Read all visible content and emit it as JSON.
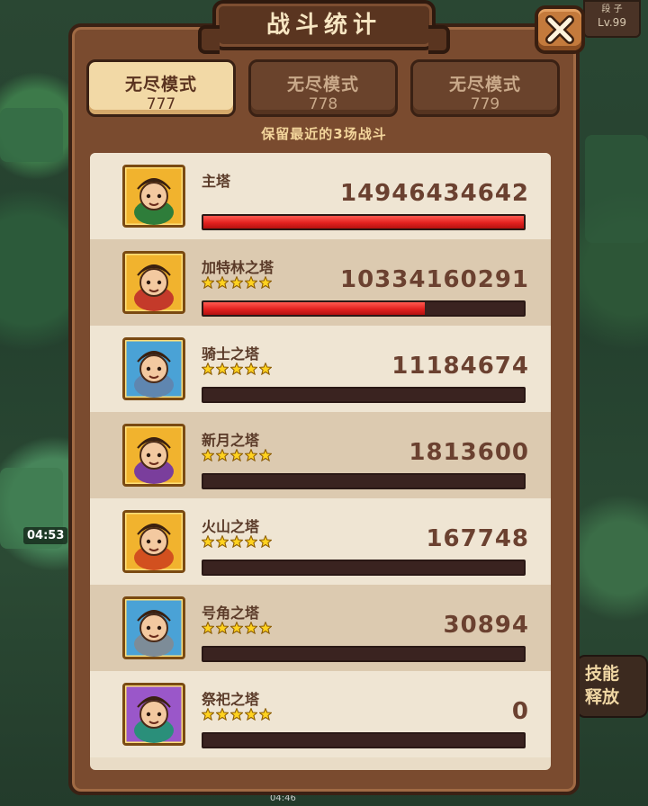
{
  "title": "战斗统计",
  "tabs": [
    {
      "mode": "无尽模式",
      "number": "777",
      "active": true
    },
    {
      "mode": "无尽模式",
      "number": "778",
      "active": false
    },
    {
      "mode": "无尽模式",
      "number": "779",
      "active": false
    }
  ],
  "subtitle": "保留最近的3场战斗",
  "background": {
    "level": "Lv.99",
    "timer": "04:53",
    "clock": "04:46",
    "skill_text": "技能\n释放"
  },
  "towers": [
    {
      "name": "主塔",
      "damage": "14946434642",
      "damage_fraction": 1.0,
      "stars": 0,
      "icon": "archer-hero-icon",
      "color": "#2e7d3a"
    },
    {
      "name": "加特林之塔",
      "damage": "10334160291",
      "damage_fraction": 0.69,
      "stars": 5,
      "icon": "gatling-hero-icon",
      "color": "#c43a2a"
    },
    {
      "name": "骑士之塔",
      "damage": "11184674",
      "damage_fraction": 0.0,
      "stars": 5,
      "icon": "knight-hero-icon",
      "color": "#5f86b0"
    },
    {
      "name": "新月之塔",
      "damage": "1813600",
      "damage_fraction": 0.0,
      "stars": 5,
      "icon": "crescent-mage-icon",
      "color": "#7a3e9c"
    },
    {
      "name": "火山之塔",
      "damage": "167748",
      "damage_fraction": 0.0,
      "stars": 5,
      "icon": "volcano-demon-icon",
      "color": "#d2501f"
    },
    {
      "name": "号角之塔",
      "damage": "30894",
      "damage_fraction": 0.0,
      "stars": 5,
      "icon": "horn-viking-icon",
      "color": "#7d8c98"
    },
    {
      "name": "祭祀之塔",
      "damage": "0",
      "damage_fraction": 0.0,
      "stars": 5,
      "icon": "tribal-shaman-icon",
      "color": "#2a8f7a"
    }
  ]
}
